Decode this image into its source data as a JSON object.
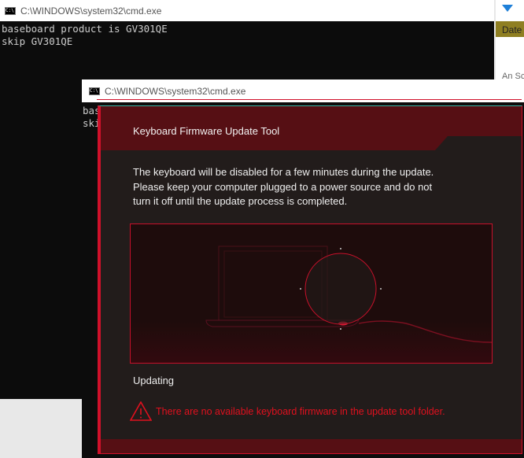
{
  "back_window": {
    "title": "C:\\WINDOWS\\system32\\cmd.exe",
    "lines": [
      "baseboard product is GV301QE",
      "skip GV301QE"
    ]
  },
  "side_window": {
    "header": "Date",
    "text": "An Sc"
  },
  "front_window": {
    "title": "C:\\WINDOWS\\system32\\cmd.exe",
    "lines": [
      "bas",
      "ski"
    ]
  },
  "dialog": {
    "title": "Keyboard Firmware Update Tool",
    "message": "The keyboard will be disabled for a few minutes during the update. Please keep your computer plugged to a power source and do not turn it off until the update process is completed.",
    "status": "Updating",
    "error": "There are no available keyboard firmware in the update tool folder."
  },
  "colors": {
    "accent": "#d0102a",
    "header": "#560f14",
    "body": "#221c1b"
  }
}
